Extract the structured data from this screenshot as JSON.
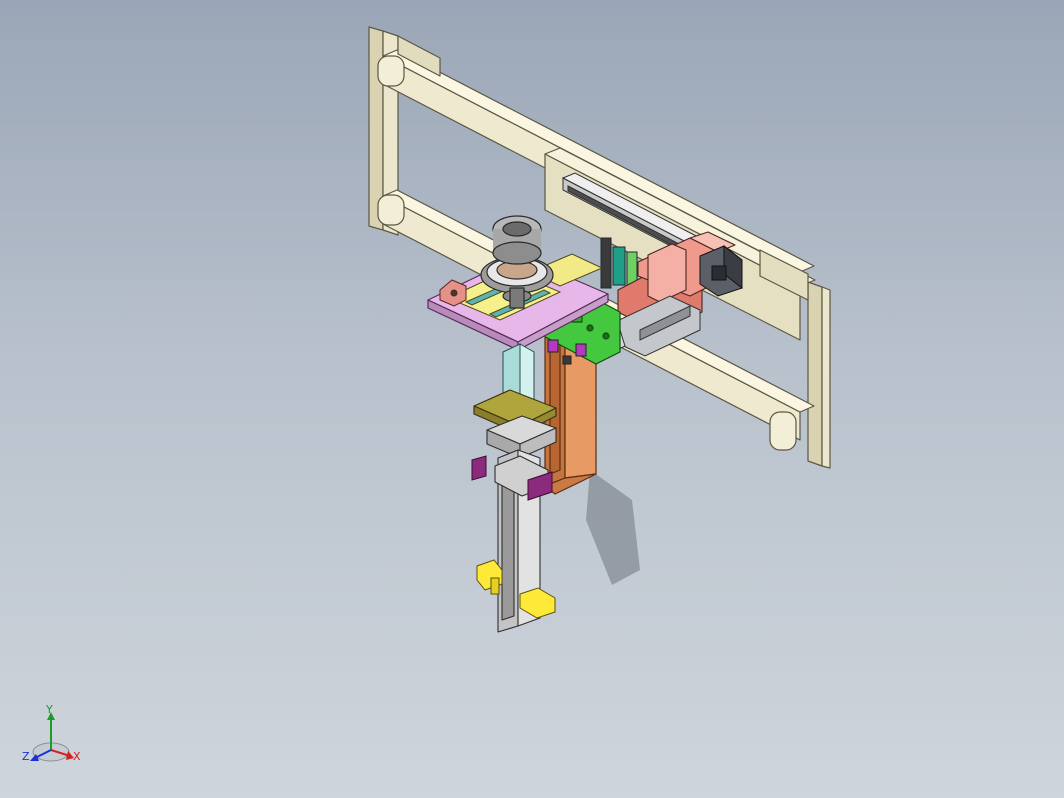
{
  "viewport": {
    "colors": {
      "bg_top": "#9aa6b7",
      "bg_bottom": "#cfd5dc",
      "frame": "#e9e4c9",
      "frame_edge": "#5a5744",
      "slide_pink": "#e57f73",
      "plate_pink": "#e6b6ea",
      "green_plate": "#3bbd39",
      "orange_channel": "#d58a55",
      "cyan_column": "#b9e7e4",
      "olive_flange": "#a89a3b",
      "purple_bracket": "#8a2b7c",
      "yellow_clamp": "#ffec3a"
    }
  },
  "triad": {
    "y_label": "Y",
    "x_label": "X",
    "z_label": "Z",
    "y_color": "#1a9b2a",
    "x_color": "#d42020",
    "z_color": "#1a32d0"
  }
}
